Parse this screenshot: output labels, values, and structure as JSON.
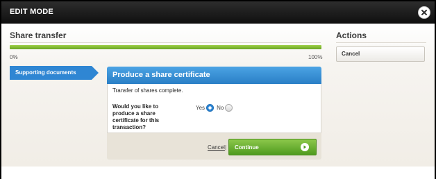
{
  "window": {
    "title": "EDIT MODE",
    "close_icon": "close-icon"
  },
  "section": {
    "title": "Share transfer"
  },
  "progress": {
    "min_label": "0%",
    "max_label": "100%",
    "value_percent": 100,
    "fill_color": "#7ab62e"
  },
  "actions": {
    "title": "Actions",
    "cancel_label": "Cancel"
  },
  "steps": {
    "current": "Supporting documents",
    "tab_color": "#2f86d3"
  },
  "panel": {
    "header": "Produce a share certificate",
    "header_color": "#3a92d8",
    "message": "Transfer of shares complete.",
    "question": "Would you like to produce a share certificate for this transaction?",
    "options": {
      "yes_label": "Yes",
      "no_label": "No",
      "selected": "Yes"
    },
    "footer": {
      "cancel_label": "Cancel",
      "separator": "|",
      "continue_label": "Continue",
      "continue_icon": "arrow-right-icon",
      "continue_color": "#6cb134"
    }
  }
}
